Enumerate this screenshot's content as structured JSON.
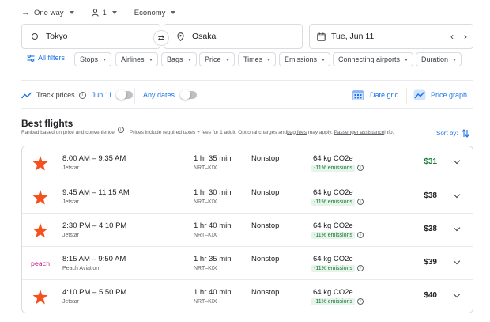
{
  "trip": {
    "type": "One way",
    "passengers": "1",
    "cabin": "Economy"
  },
  "search": {
    "origin": "Tokyo",
    "destination": "Osaka",
    "date": "Tue, Jun 11"
  },
  "filters": {
    "all_label": "All filters",
    "chips": [
      "Stops",
      "Airlines",
      "Bags",
      "Price",
      "Times",
      "Emissions",
      "Connecting airports",
      "Duration"
    ]
  },
  "tracking": {
    "track_label": "Track prices",
    "track_date": "Jun 11",
    "any_dates_label": "Any dates",
    "date_grid_label": "Date grid",
    "price_graph_label": "Price graph"
  },
  "results": {
    "heading": "Best flights",
    "ranked_text": "Ranked based on price and convenience",
    "note_prefix": "Prices include required taxes + fees for 1 adult. Optional charges and ",
    "bag_fees_link": "bag fees",
    "note_middle": " may apply. ",
    "assistance_link": "Passenger assistance",
    "note_suffix": " info.",
    "sort_label": "Sort by:"
  },
  "flights": [
    {
      "times": "8:00 AM – 9:35 AM",
      "airline": "Jetstar",
      "duration": "1 hr 35 min",
      "route": "NRT–KIX",
      "stops": "Nonstop",
      "co2": "64 kg CO2e",
      "emissions": "-11% emissions",
      "price": "$31",
      "logo": "jetstar-star-icon"
    },
    {
      "times": "9:45 AM – 11:15 AM",
      "airline": "Jetstar",
      "duration": "1 hr 30 min",
      "route": "NRT–KIX",
      "stops": "Nonstop",
      "co2": "64 kg CO2e",
      "emissions": "-11% emissions",
      "price": "$38",
      "logo": "jetstar-star-icon"
    },
    {
      "times": "2:30 PM – 4:10 PM",
      "airline": "Jetstar",
      "duration": "1 hr 40 min",
      "route": "NRT–KIX",
      "stops": "Nonstop",
      "co2": "64 kg CO2e",
      "emissions": "-11% emissions",
      "price": "$38",
      "logo": "jetstar-star-icon"
    },
    {
      "times": "8:15 AM – 9:50 AM",
      "airline": "Peach Aviation",
      "duration": "1 hr 35 min",
      "route": "NRT–KIX",
      "stops": "Nonstop",
      "co2": "64 kg CO2e",
      "emissions": "-11% emissions",
      "price": "$39",
      "logo": "peach-logo",
      "logo_text": "peach"
    },
    {
      "times": "4:10 PM – 5:50 PM",
      "airline": "Jetstar",
      "duration": "1 hr 40 min",
      "route": "NRT–KIX",
      "stops": "Nonstop",
      "co2": "64 kg CO2e",
      "emissions": "-11% emissions",
      "price": "$40",
      "logo": "jetstar-star-icon"
    }
  ],
  "colors": {
    "accent": "#1a73e8",
    "jetstar": "#f4511e",
    "peach": "#c0188c",
    "cheapest": "#188038",
    "emissions_bg": "#e6f4ea"
  }
}
